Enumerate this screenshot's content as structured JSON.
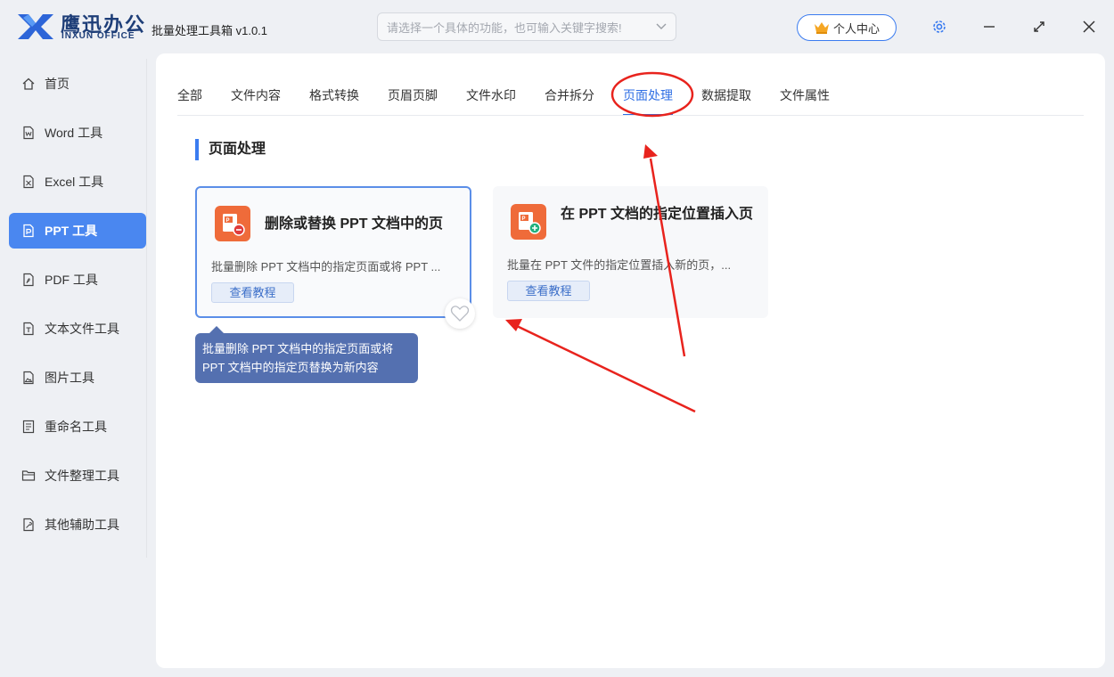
{
  "app": {
    "brand_cn": "鹰迅办公",
    "brand_en": "INXUN OFFICE",
    "title": "批量处理工具箱 v1.0.1"
  },
  "search": {
    "placeholder": "请选择一个具体的功能，也可输入关键字搜索!"
  },
  "header": {
    "user_center_label": "个人中心"
  },
  "colors": {
    "accent": "#3b7cf0",
    "active_sidebar": "#4a87f0",
    "card_icon": "#ef6b3a",
    "annotation": "#e8231d",
    "tooltip_bg": "#5470b0"
  },
  "sidebar": {
    "items": [
      {
        "label": "首页",
        "icon": "home-icon"
      },
      {
        "label": "Word 工具",
        "icon": "word-file-icon"
      },
      {
        "label": "Excel 工具",
        "icon": "excel-file-icon"
      },
      {
        "label": "PPT 工具",
        "icon": "ppt-file-icon",
        "active": true
      },
      {
        "label": "PDF 工具",
        "icon": "pdf-file-icon"
      },
      {
        "label": "文本文件工具",
        "icon": "text-file-icon"
      },
      {
        "label": "图片工具",
        "icon": "image-file-icon"
      },
      {
        "label": "重命名工具",
        "icon": "rename-icon"
      },
      {
        "label": "文件整理工具",
        "icon": "folder-icon"
      },
      {
        "label": "其他辅助工具",
        "icon": "tools-icon"
      }
    ]
  },
  "tabs": [
    {
      "label": "全部"
    },
    {
      "label": "文件内容"
    },
    {
      "label": "格式转换"
    },
    {
      "label": "页眉页脚"
    },
    {
      "label": "文件水印"
    },
    {
      "label": "合并拆分"
    },
    {
      "label": "页面处理",
      "active": true
    },
    {
      "label": "数据提取"
    },
    {
      "label": "文件属性"
    }
  ],
  "section": {
    "title": "页面处理"
  },
  "cards": [
    {
      "title": "删除或替换 PPT 文档中的页",
      "description": "批量删除 PPT 文档中的指定页面或将 PPT ...",
      "tutorial_label": "查看教程",
      "icon": "ppt-delete-page-icon"
    },
    {
      "title": "在 PPT 文档的指定位置插入页",
      "description": "批量在 PPT 文件的指定位置插入新的页，...",
      "tutorial_label": "查看教程",
      "icon": "ppt-insert-page-icon"
    }
  ],
  "tooltip": {
    "line1": "批量删除 PPT 文档中的指定页面或将",
    "line2": "PPT 文档中的指定页替换为新内容"
  }
}
